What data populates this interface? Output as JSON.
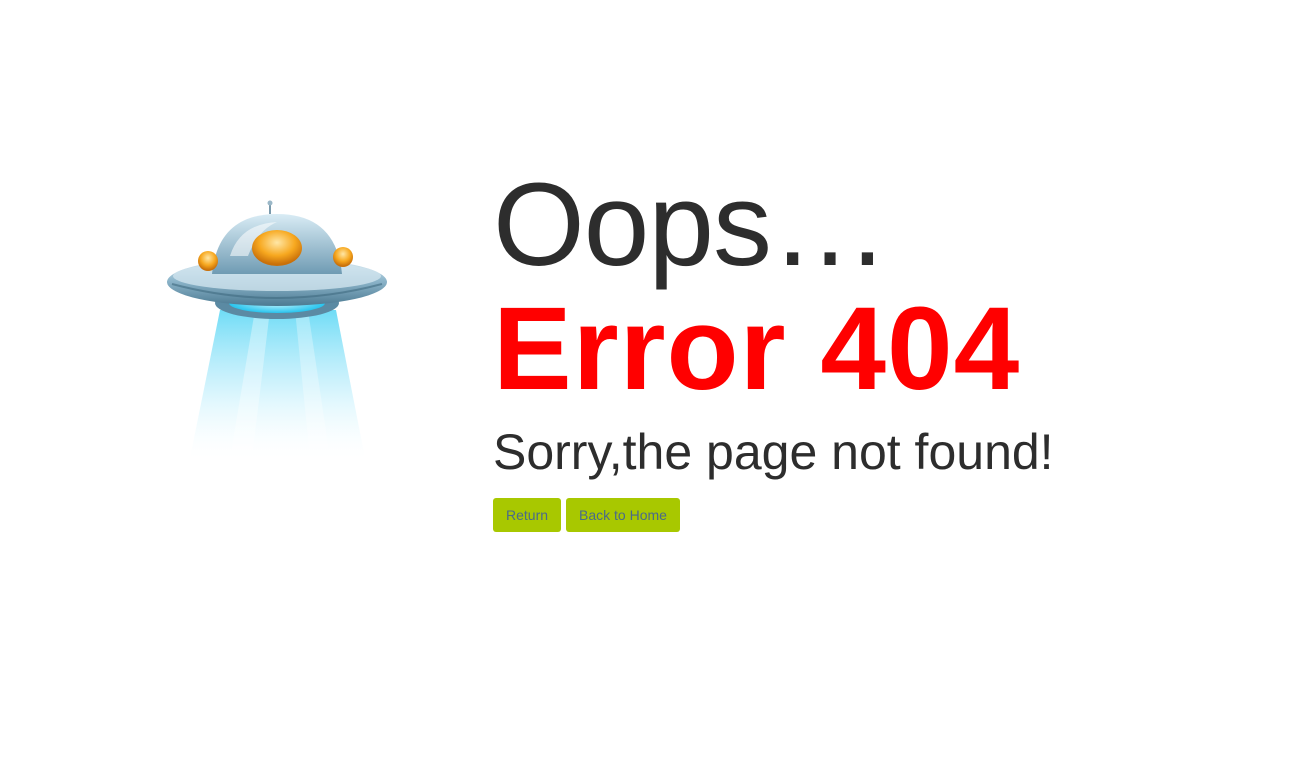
{
  "heading": {
    "oops": "Oops…",
    "error": "Error 404",
    "message": "Sorry,the page not found!"
  },
  "buttons": {
    "return_label": "Return",
    "home_label": "Back to Home"
  },
  "colors": {
    "error": "#ff0000",
    "text": "#2d2d2d",
    "button_bg": "#a8c800",
    "button_text": "#4a6a8a"
  },
  "illustration": {
    "icon": "ufo-icon"
  }
}
